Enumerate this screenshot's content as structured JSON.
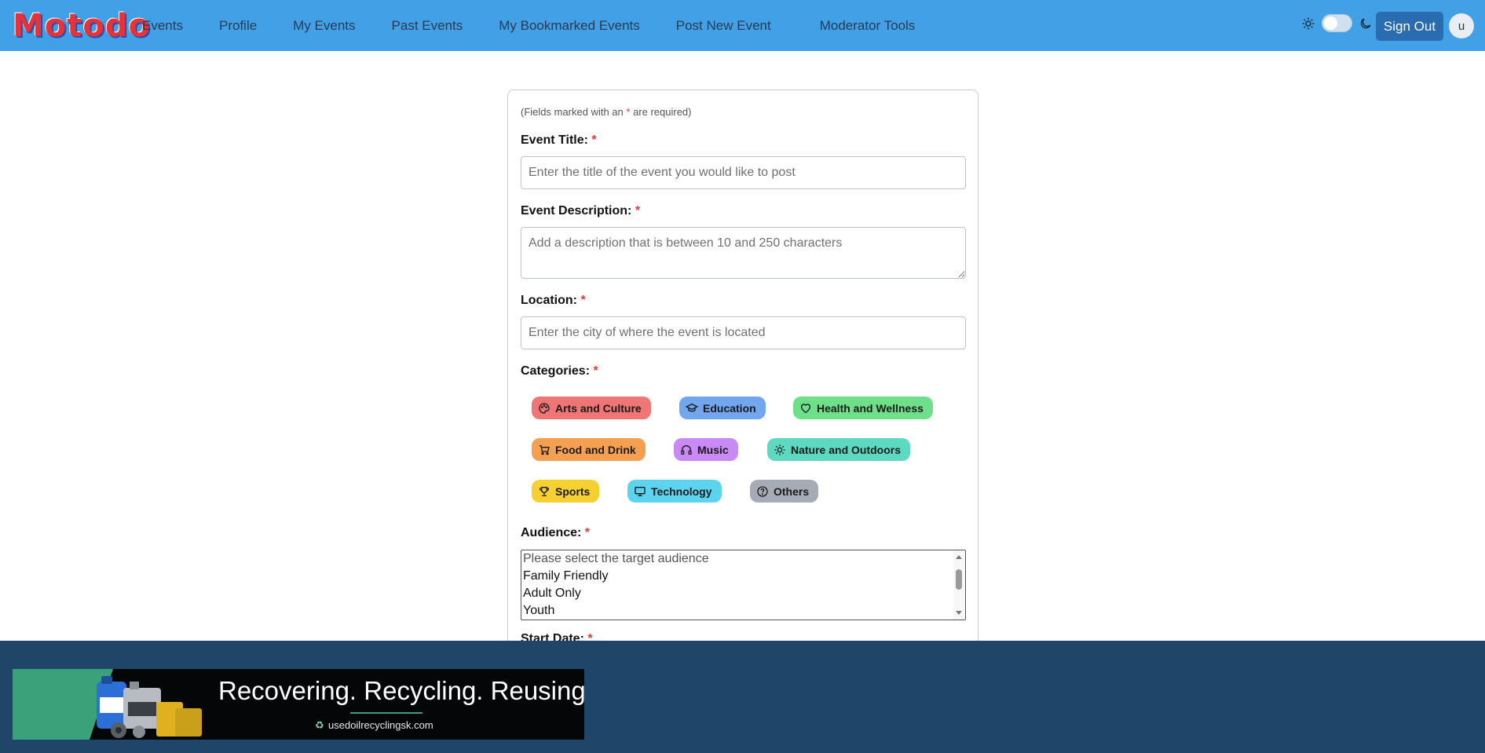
{
  "brand": {
    "logo_text": "Motodo"
  },
  "nav": {
    "links": [
      "Events",
      "Profile",
      "My Events",
      "Past Events",
      "My Bookmarked Events",
      "Post New Event",
      "Moderator Tools"
    ],
    "sign_out": "Sign Out",
    "avatar_initial": "u"
  },
  "form": {
    "required_note_prefix": "(Fields marked with an ",
    "required_note_star": "*",
    "required_note_suffix": " are required)",
    "event_title": {
      "label": "Event Title:",
      "placeholder": "Enter the title of the event you would like to post"
    },
    "event_description": {
      "label": "Event Description:",
      "placeholder": "Add a description that is between 10 and 250 characters"
    },
    "location": {
      "label": "Location:",
      "placeholder": "Enter the city of where the event is located"
    },
    "categories": {
      "label": "Categories:",
      "items": [
        {
          "label": "Arts and Culture",
          "icon": "palette-icon",
          "color": "#f07575"
        },
        {
          "label": "Education",
          "icon": "graduation-cap-icon",
          "color": "#72a7f0"
        },
        {
          "label": "Health and Wellness",
          "icon": "heart-icon",
          "color": "#6fe08a"
        },
        {
          "label": "Food and Drink",
          "icon": "cart-icon",
          "color": "#f5a050"
        },
        {
          "label": "Music",
          "icon": "headphones-icon",
          "color": "#c98af5"
        },
        {
          "label": "Nature and Outdoors",
          "icon": "sun-icon",
          "color": "#5cd9c0"
        },
        {
          "label": "Sports",
          "icon": "trophy-icon",
          "color": "#f5d030"
        },
        {
          "label": "Technology",
          "icon": "monitor-icon",
          "color": "#5cd4f0"
        },
        {
          "label": "Others",
          "icon": "question-circle-icon",
          "color": "#a6acb5"
        }
      ]
    },
    "audience": {
      "label": "Audience:",
      "options": [
        "Please select the target audience",
        "Family Friendly",
        "Adult Only",
        "Youth"
      ]
    },
    "start_date": {
      "label": "Start Date:"
    },
    "required_star": "*"
  },
  "ad": {
    "headline": "Recovering. Recycling. Reusing.",
    "url": "usedoilrecyclingsk.com"
  },
  "colors": {
    "nav_bg": "#42a0e6",
    "sign_out_bg": "#2a6cb0",
    "footer_bg": "#1f4668",
    "required_star": "#e03b3b"
  }
}
